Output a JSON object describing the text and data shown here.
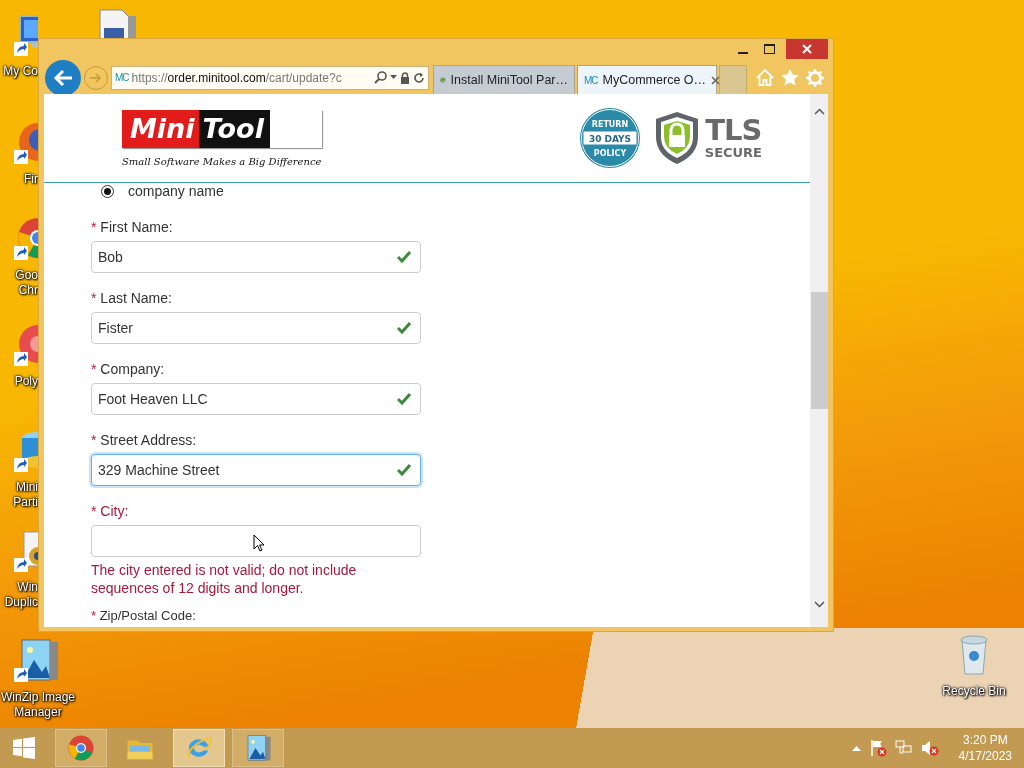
{
  "desktop": {
    "icons": [
      {
        "kind": "computer",
        "lines": [
          "My Co"
        ]
      },
      {
        "kind": "pdf"
      },
      {
        "kind": "firefox",
        "lines": [
          "Fir"
        ]
      },
      {
        "kind": "chrome",
        "lines": [
          "Goo",
          "Chr"
        ]
      },
      {
        "kind": "poly",
        "lines": [
          "Poly"
        ]
      },
      {
        "kind": "partition",
        "lines": [
          "Mini",
          "Parti"
        ]
      },
      {
        "kind": "duplicate",
        "lines": [
          "Win",
          "Duplic"
        ]
      },
      {
        "kind": "winzip",
        "lines": [
          "WinZip Image",
          "Manager"
        ]
      },
      {
        "kind": "recycle",
        "lines": [
          "Recycle Bin"
        ]
      }
    ]
  },
  "browser": {
    "address": {
      "favicon": "MC",
      "url": "https://**order.minitool.com**/cart/update?c"
    },
    "tabs": [
      {
        "title": "Install MiniTool Par…",
        "selected": false
      },
      {
        "favicon": "MC",
        "title": "MyCommerce O…",
        "selected": true
      }
    ],
    "page": {
      "logo": {
        "left": "Mini",
        "right": "Tool",
        "tagline": "Small Software Makes a Big Difference"
      },
      "return_badge": {
        "top": "RETURN",
        "middle": "30 DAYS",
        "bottom": "POLICY"
      },
      "tls_badge": {
        "title": "TLS",
        "subtitle": "SECURE"
      },
      "radio": {
        "label": "company name",
        "selected": true
      },
      "fields": [
        {
          "mark": "*",
          "label": "First Name:",
          "value": "Bob",
          "valid": true,
          "focused": false
        },
        {
          "mark": "*",
          "label": "Last Name:",
          "value": "Fister",
          "valid": true,
          "focused": false
        },
        {
          "mark": "*",
          "label": "Company:",
          "value": "Foot Heaven LLC",
          "valid": true,
          "focused": false
        },
        {
          "mark": "*",
          "label": "Street Address:",
          "value": "329 Machine Street",
          "valid": true,
          "focused": true
        },
        {
          "mark": "*",
          "label": "City:",
          "valid": false,
          "focused": false,
          "error": "The city entered is not valid; do not include sequences of 12 digits and longer."
        }
      ],
      "next_field": {
        "mark": "*",
        "label": "Zip/Postal Code:"
      }
    }
  },
  "taskbar": {
    "apps": [
      {
        "kind": "chrome",
        "running": true,
        "active": false
      },
      {
        "kind": "explorer",
        "running": false,
        "active": false
      },
      {
        "kind": "ie",
        "running": true,
        "active": true
      },
      {
        "kind": "winzip",
        "running": true,
        "active": false
      }
    ],
    "clock": {
      "time": "3:20 PM",
      "date": "4/17/2023"
    }
  }
}
